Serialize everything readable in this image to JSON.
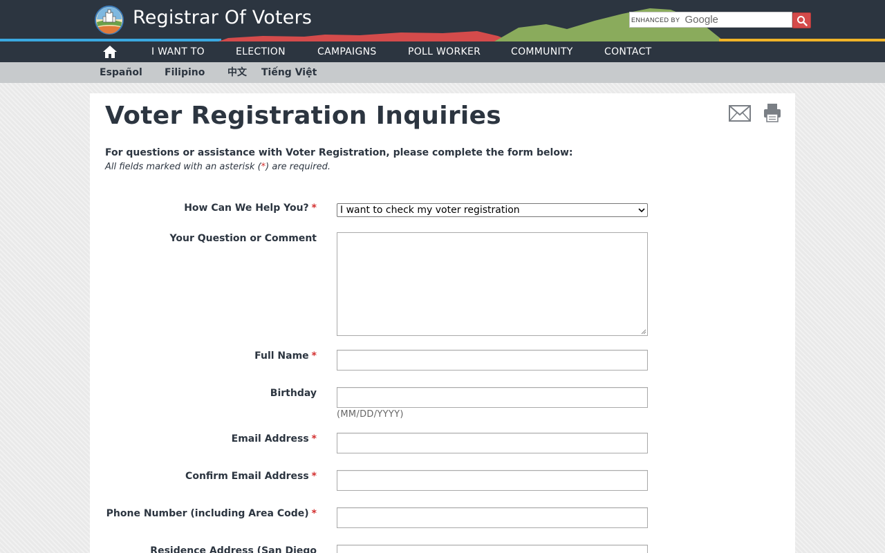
{
  "header": {
    "site_title": "Registrar Of Voters",
    "search": {
      "enhanced_by": "ENHANCED BY",
      "provider": "Google",
      "value": ""
    }
  },
  "nav": {
    "items": [
      {
        "label": "I WANT TO"
      },
      {
        "label": "ELECTION"
      },
      {
        "label": "CAMPAIGNS"
      },
      {
        "label": "POLL WORKER"
      },
      {
        "label": "COMMUNITY"
      },
      {
        "label": "CONTACT"
      }
    ]
  },
  "languages": {
    "items": [
      {
        "label": "Español"
      },
      {
        "label": "Filipino"
      },
      {
        "label": "中文"
      },
      {
        "label": "Tiếng Việt"
      }
    ]
  },
  "page": {
    "title": "Voter Registration Inquiries",
    "intro": "For questions or assistance with Voter Registration, please complete the form below:",
    "required_note_pre": "All fields marked with an asterisk (",
    "required_note_star": "*",
    "required_note_post": ") are required."
  },
  "form": {
    "help": {
      "label": "How Can We Help You?",
      "required_mark": "*",
      "selected": "I want to check my voter registration"
    },
    "question": {
      "label": "Your Question or Comment",
      "value": ""
    },
    "full_name": {
      "label": "Full Name",
      "required_mark": "*",
      "value": ""
    },
    "birthday": {
      "label": "Birthday",
      "value": "",
      "hint": "(MM/DD/YYYY)"
    },
    "email": {
      "label": "Email Address",
      "required_mark": "*",
      "value": ""
    },
    "confirm_email": {
      "label": "Confirm Email Address",
      "required_mark": "*",
      "value": ""
    },
    "phone": {
      "label": "Phone Number (including Area Code)",
      "required_mark": "*",
      "value": ""
    },
    "residence": {
      "label": "Residence Address (San Diego",
      "value": ""
    }
  },
  "colors": {
    "header_bg": "#2c3540",
    "accent_blue": "#3aa8e0",
    "accent_red": "#d44b4b",
    "accent_green": "#8aab5c",
    "accent_yellow": "#f0b428",
    "required_star": "#d32f2f"
  },
  "icons": [
    "logo-icon",
    "search-icon",
    "home-icon",
    "mail-icon",
    "print-icon",
    "chevron-down-icon"
  ]
}
